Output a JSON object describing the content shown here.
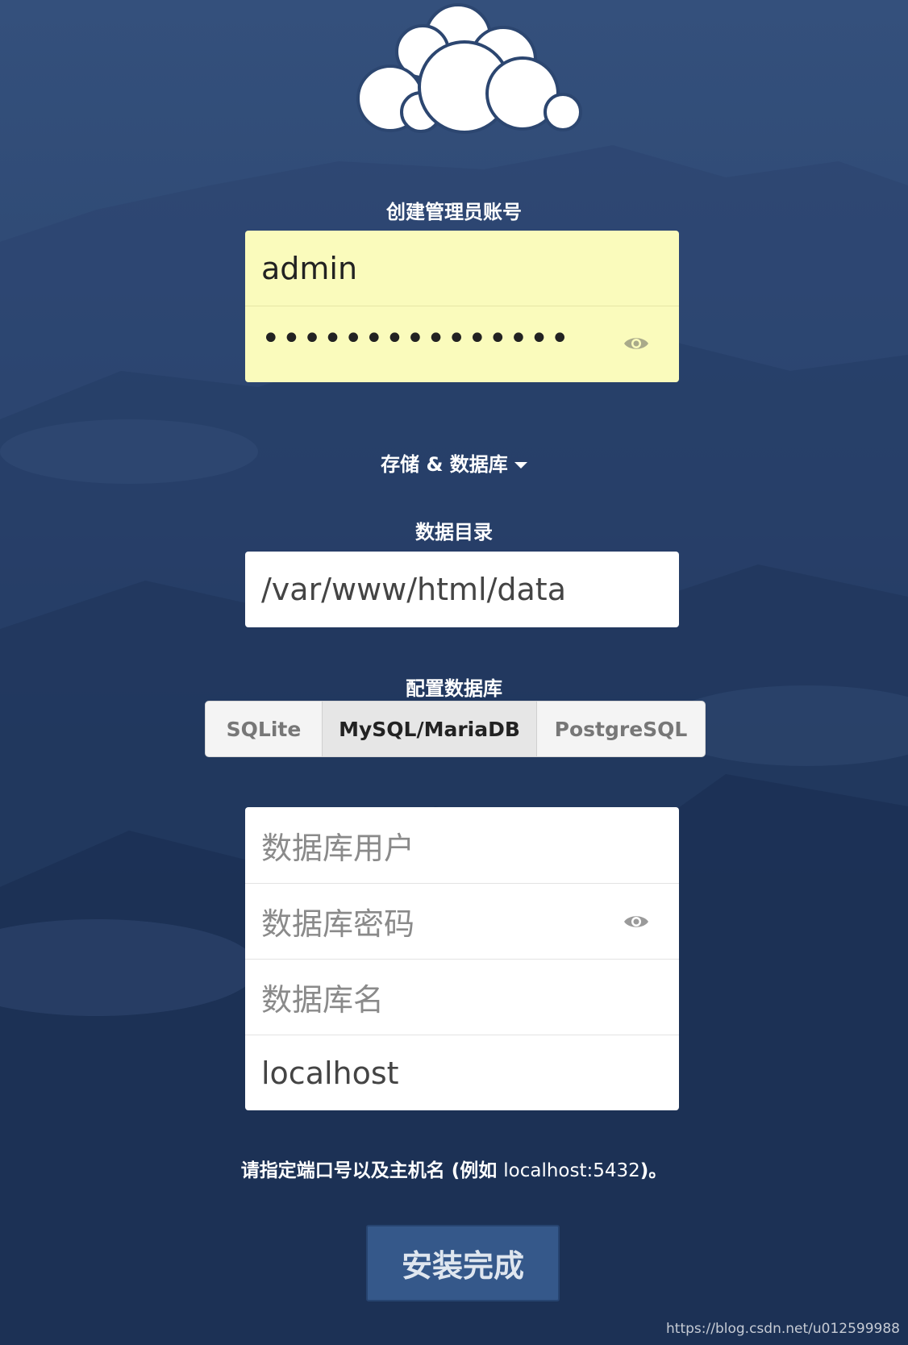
{
  "admin_section": {
    "title": "创建管理员账号",
    "username_value": "admin",
    "password_dots": "•••••••••••••••"
  },
  "storage_toggle": {
    "label": "存储 & 数据库"
  },
  "data_dir": {
    "title": "数据目录",
    "value": "/var/www/html/data"
  },
  "db_config": {
    "title": "配置数据库",
    "tabs": [
      "SQLite",
      "MySQL/MariaDB",
      "PostgreSQL"
    ],
    "selected": "MySQL/MariaDB"
  },
  "db_fields": {
    "user_placeholder": "数据库用户",
    "password_placeholder": "数据库密码",
    "name_placeholder": "数据库名",
    "host_value": "localhost"
  },
  "hint": {
    "text_main": "请指定端口号以及主机名 (例如",
    "text_example": "localhost:5432",
    "text_end": ")。"
  },
  "submit_label": "安装完成",
  "watermark": "https://blog.csdn.net/u012599988",
  "colors": {
    "background": "#2c4670",
    "autofill": "#fafbbc",
    "button": "#35588a"
  }
}
